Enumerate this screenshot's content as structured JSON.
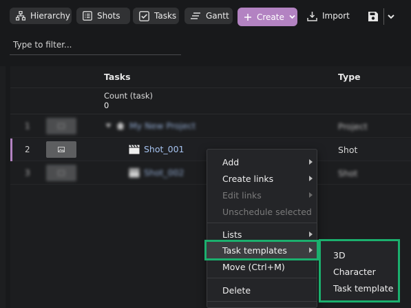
{
  "toolbar": {
    "hierarchy": "Hierarchy",
    "shots": "Shots",
    "tasks": "Tasks",
    "gantt": "Gantt",
    "create": "Create",
    "import": "Import"
  },
  "filter": {
    "placeholder": "Type to filter..."
  },
  "grid": {
    "header_tasks": "Tasks",
    "header_type": "Type",
    "count_label": "Count (task)",
    "count_value": "0",
    "rows": [
      {
        "num": "1",
        "name": "My New Project",
        "type": "Project"
      },
      {
        "num": "2",
        "name": "Shot_001",
        "type": "Shot"
      },
      {
        "num": "3",
        "name": "Shot_002",
        "type": "Shot"
      }
    ]
  },
  "context_menu": {
    "items": [
      {
        "label": "Add",
        "disabled": false
      },
      {
        "label": "Create links",
        "disabled": false
      },
      {
        "label": "Edit links",
        "disabled": true
      },
      {
        "label": "Unschedule selected",
        "disabled": true
      },
      {
        "label": "Lists",
        "disabled": false
      },
      {
        "label": "Task templates",
        "disabled": false
      },
      {
        "label": "Move (Ctrl+M)",
        "disabled": false
      },
      {
        "label": "Delete",
        "disabled": false
      }
    ]
  },
  "submenu": {
    "items": [
      "3D",
      "Character",
      "Task template"
    ]
  },
  "colors": {
    "accent": "#b383c2",
    "highlight_border": "#1bb06e",
    "link": "#a6c3f0"
  }
}
